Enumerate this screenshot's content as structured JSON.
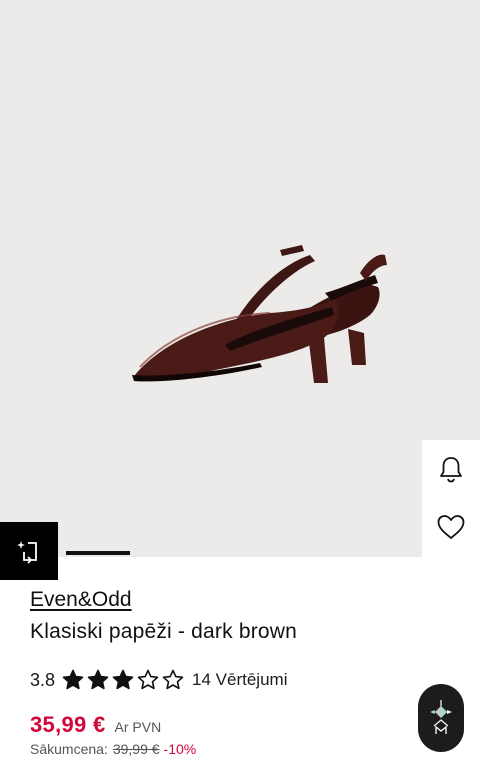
{
  "product": {
    "brand": "Even&Odd",
    "title": "Klasiski papēži - dark brown",
    "rating": "3.8",
    "rating_stars": 3.8,
    "reviews_label": "14 Vērtējumi",
    "price": "35,99 €",
    "vat_label": "Ar PVN",
    "original_label": "Sākumcena:",
    "original_price": "39,99 €",
    "discount": "-10%"
  },
  "gallery": {
    "image_index": 1,
    "image_count": 7
  },
  "icons": {
    "similar": "similar-items-icon",
    "bell": "bell-icon",
    "heart": "heart-icon",
    "assistant": "assistant-logo-icon"
  },
  "colors": {
    "price_red": "#d3063a",
    "hero_bg": "#ecebea",
    "shoe": "#4a1a16"
  }
}
